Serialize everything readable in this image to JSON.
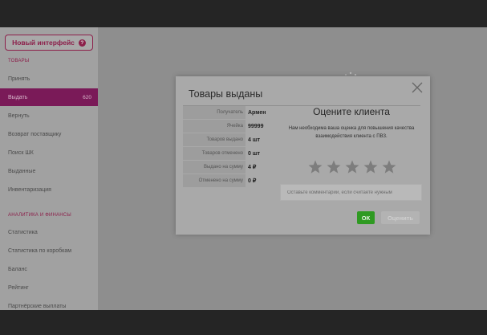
{
  "sidebar": {
    "new_ui_label": "Новый интерфейс",
    "new_ui_icon": "question-icon",
    "goods_section": "ТОВАРЫ",
    "goods_items": [
      {
        "label": "Принять"
      },
      {
        "label": "Выдать",
        "badge": "620"
      },
      {
        "label": "Вернуть"
      },
      {
        "label": "Возврат поставщику"
      },
      {
        "label": "Поиск ШК"
      },
      {
        "label": "Выданные"
      },
      {
        "label": "Инвентаризация"
      }
    ],
    "analytics_section": "АНАЛИТИКА И ФИНАНСЫ",
    "analytics_items": [
      {
        "label": "Статистика"
      },
      {
        "label": "Статистика по коробкам"
      },
      {
        "label": "Баланс"
      },
      {
        "label": "Рейтинг"
      },
      {
        "label": "Партнёрские выплаты"
      }
    ]
  },
  "modal": {
    "title": "Товары выданы",
    "close_icon": "close-icon",
    "info": [
      {
        "label": "Получатель",
        "value": "Армен"
      },
      {
        "label": "Ячейка",
        "value": "99999"
      },
      {
        "label": "Товаров выдано",
        "value": "4 шт"
      },
      {
        "label": "Товаров отменено",
        "value": "0 шт"
      },
      {
        "label": "Выдано на сумму",
        "value": "4 ₽"
      },
      {
        "label": "Отменено на сумму",
        "value": "0 ₽"
      }
    ],
    "rating": {
      "title": "Оцените клиента",
      "description": "Нам необходима ваша оценка для повышения качества взаимодействия клиента с ПВЗ.",
      "stars_total": 5,
      "stars_selected": 0,
      "comment_placeholder": "Оставьте комментарий, если считаете нужным",
      "comment_value": ""
    },
    "ok_label": "ОК",
    "rate_label": "Оценить"
  },
  "colors": {
    "accent": "#8c1f4a",
    "active_nav": "#7a1a58",
    "ok_button": "#2f9a22"
  }
}
